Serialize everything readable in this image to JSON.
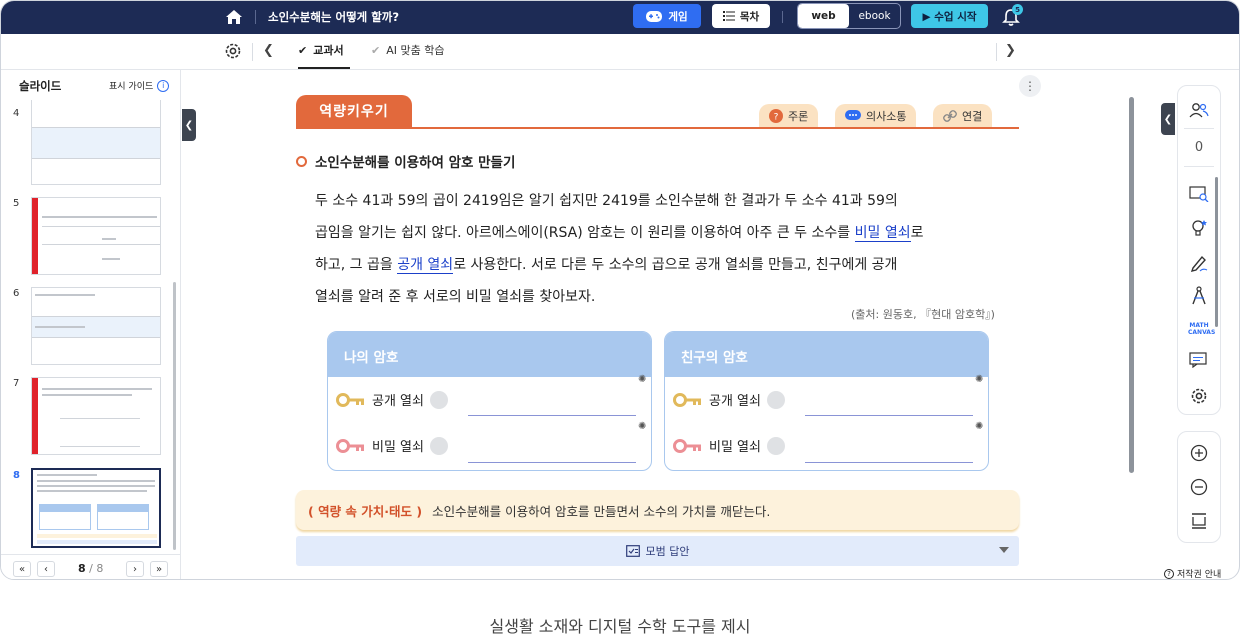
{
  "topbar": {
    "title": "소인수분해는 어떻게 할까?",
    "game_label": "게임",
    "toc_label": "목차",
    "view_web": "web",
    "view_ebook": "ebook",
    "start_label": "▶ 수업 시작",
    "notification_count": "5"
  },
  "subbar": {
    "tabs": [
      {
        "label": "교과서",
        "checked": true,
        "active": true
      },
      {
        "label": "AI 맞춤 학습",
        "checked": true,
        "active": false
      }
    ]
  },
  "sidebar": {
    "title": "슬라이드",
    "guide_label": "표시 가이드",
    "slides": [
      {
        "num": "4"
      },
      {
        "num": "5",
        "lines": [
          "40 40",
          "20 220"
        ]
      },
      {
        "num": "6"
      },
      {
        "num": "7"
      },
      {
        "num": "8",
        "active": true
      }
    ],
    "page_current": "8",
    "page_sep": "/",
    "page_total": "8"
  },
  "lesson": {
    "banner": "역량키우기",
    "tags": [
      "주론",
      "의사소통",
      "연결"
    ],
    "heading": "소인수분해를 이용하여 암호 만들기",
    "para": {
      "l1": "두 소수 41과 59의 곱이 2419임은 알기 쉽지만 2419를 소인수분해 한 결과가 두 소수 41과 59의",
      "l2a": "곱임을 알기는 쉽지 않다. 아르에스에이(RSA) 암호는 이 원리를 이용하여 아주 큰 두 소수를 ",
      "l2b": "비밀 열쇠",
      "l2c": "로",
      "l3a": "하고, 그 곱을 ",
      "l3b": "공개 열쇠",
      "l3c": "로 사용한다. 서로 다른 두 소수의 곱으로 공개 열쇠를 만들고, 친구에게 공개",
      "l4": "열쇠를 알려 준 후 서로의 비밀 열쇠를 찾아보자."
    },
    "source": "(출처: 원동호, 『현대 암호학』)",
    "cards": [
      {
        "title": "나의 암호",
        "public_label": "공개 열쇠",
        "secret_label": "비밀 열쇠"
      },
      {
        "title": "친구의 암호",
        "public_label": "공개 열쇠",
        "secret_label": "비밀 열쇠"
      }
    ],
    "value_tag": "( 역량 속 가치·태도 )",
    "value_text": "소인수분해를 이용하여 암호를 만들면서 소수의 가치를 깨닫는다.",
    "answer_label": "모범 답안"
  },
  "rightpanel": {
    "participants": "0",
    "math_canvas": "MATH CANVAS"
  },
  "copyright_label": "저작권 안내",
  "caption": "실생활 소재와 디지털 수학 도구를 제시",
  "colors": {
    "navy": "#1d2b55",
    "accent_blue": "#2f6df2",
    "cyan": "#3ec7e7",
    "orange": "#e2693c",
    "card_blue": "#a9c8ee"
  }
}
